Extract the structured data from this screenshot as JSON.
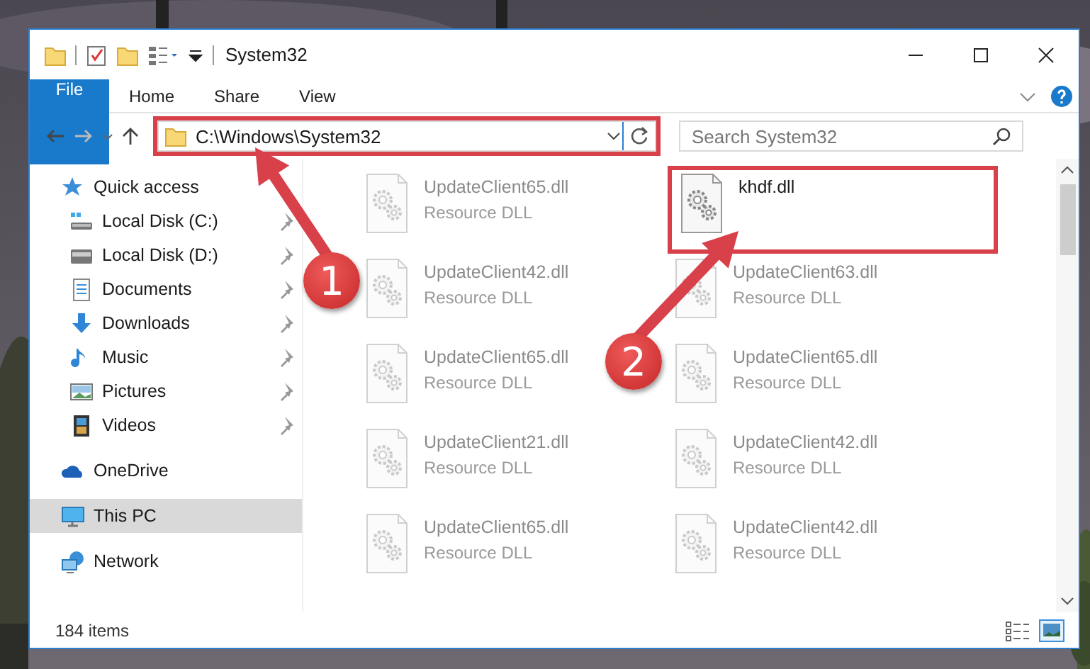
{
  "window": {
    "title": "System32"
  },
  "ribbon_tabs": [
    {
      "label": "File",
      "kind": "file"
    },
    {
      "label": "Home",
      "kind": "tab"
    },
    {
      "label": "Share",
      "kind": "tab"
    },
    {
      "label": "View",
      "kind": "tab"
    }
  ],
  "address_bar": {
    "path": "C:\\Windows\\System32",
    "highlighted": true
  },
  "search": {
    "placeholder": "Search System32"
  },
  "navigation": [
    {
      "label": "Quick access",
      "kind": "star",
      "selected": false,
      "children": [
        {
          "label": "Local Disk (C:)",
          "kind": "system-drive",
          "pinned": true,
          "selected": false
        },
        {
          "label": "Local Disk (D:)",
          "kind": "drive",
          "pinned": true,
          "selected": false
        },
        {
          "label": "Documents",
          "kind": "document",
          "pinned": true,
          "selected": false
        },
        {
          "label": "Downloads",
          "kind": "download",
          "pinned": true,
          "selected": false
        },
        {
          "label": "Music",
          "kind": "music",
          "pinned": true,
          "selected": false
        },
        {
          "label": "Pictures",
          "kind": "pictures",
          "pinned": true,
          "selected": false
        },
        {
          "label": "Videos",
          "kind": "videos",
          "pinned": true,
          "selected": false
        }
      ]
    },
    {
      "label": "OneDrive",
      "kind": "cloud",
      "selected": false
    },
    {
      "label": "This PC",
      "kind": "computer",
      "selected": true
    },
    {
      "label": "Network",
      "kind": "network",
      "selected": false
    }
  ],
  "files": [
    {
      "name": "UpdateClient65.dll",
      "type": "Resource DLL",
      "blurred": true,
      "highlighted": false
    },
    {
      "name": "khdf.dll",
      "blurred": false,
      "highlighted": true
    },
    {
      "name": "UpdateClient42.dll",
      "type": "Resource DLL",
      "blurred": true,
      "highlighted": false
    },
    {
      "name": "UpdateClient63.dll",
      "type": "Resource DLL",
      "blurred": true,
      "highlighted": false
    },
    {
      "name": "UpdateClient65.dll",
      "type": "Resource DLL",
      "blurred": true,
      "highlighted": false
    },
    {
      "name": "UpdateClient65.dll",
      "type": "Resource DLL",
      "blurred": true,
      "highlighted": false
    },
    {
      "name": "UpdateClient21.dll",
      "type": "Resource DLL",
      "blurred": true,
      "highlighted": false
    },
    {
      "name": "UpdateClient42.dll",
      "type": "Resource DLL",
      "blurred": true,
      "highlighted": false
    },
    {
      "name": "UpdateClient65.dll",
      "type": "Resource DLL",
      "blurred": true,
      "highlighted": false
    },
    {
      "name": "UpdateClient42.dll",
      "type": "Resource DLL",
      "blurred": true,
      "highlighted": false
    }
  ],
  "status_bar": {
    "item_count": "184 items"
  },
  "callouts": [
    {
      "number": "1"
    },
    {
      "number": "2"
    }
  ]
}
